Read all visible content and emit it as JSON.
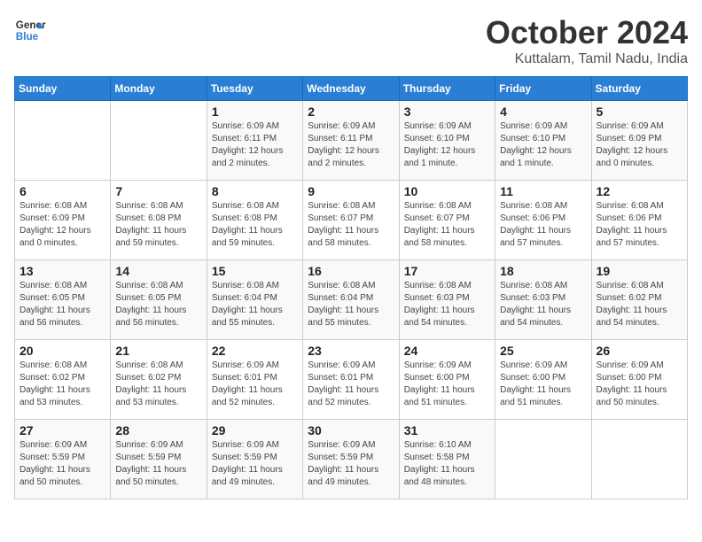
{
  "header": {
    "logo_line1": "General",
    "logo_line2": "Blue",
    "month": "October 2024",
    "location": "Kuttalam, Tamil Nadu, India"
  },
  "weekdays": [
    "Sunday",
    "Monday",
    "Tuesday",
    "Wednesday",
    "Thursday",
    "Friday",
    "Saturday"
  ],
  "weeks": [
    [
      {
        "day": "",
        "info": ""
      },
      {
        "day": "",
        "info": ""
      },
      {
        "day": "1",
        "info": "Sunrise: 6:09 AM\nSunset: 6:11 PM\nDaylight: 12 hours and 2 minutes."
      },
      {
        "day": "2",
        "info": "Sunrise: 6:09 AM\nSunset: 6:11 PM\nDaylight: 12 hours and 2 minutes."
      },
      {
        "day": "3",
        "info": "Sunrise: 6:09 AM\nSunset: 6:10 PM\nDaylight: 12 hours and 1 minute."
      },
      {
        "day": "4",
        "info": "Sunrise: 6:09 AM\nSunset: 6:10 PM\nDaylight: 12 hours and 1 minute."
      },
      {
        "day": "5",
        "info": "Sunrise: 6:09 AM\nSunset: 6:09 PM\nDaylight: 12 hours and 0 minutes."
      }
    ],
    [
      {
        "day": "6",
        "info": "Sunrise: 6:08 AM\nSunset: 6:09 PM\nDaylight: 12 hours and 0 minutes."
      },
      {
        "day": "7",
        "info": "Sunrise: 6:08 AM\nSunset: 6:08 PM\nDaylight: 11 hours and 59 minutes."
      },
      {
        "day": "8",
        "info": "Sunrise: 6:08 AM\nSunset: 6:08 PM\nDaylight: 11 hours and 59 minutes."
      },
      {
        "day": "9",
        "info": "Sunrise: 6:08 AM\nSunset: 6:07 PM\nDaylight: 11 hours and 58 minutes."
      },
      {
        "day": "10",
        "info": "Sunrise: 6:08 AM\nSunset: 6:07 PM\nDaylight: 11 hours and 58 minutes."
      },
      {
        "day": "11",
        "info": "Sunrise: 6:08 AM\nSunset: 6:06 PM\nDaylight: 11 hours and 57 minutes."
      },
      {
        "day": "12",
        "info": "Sunrise: 6:08 AM\nSunset: 6:06 PM\nDaylight: 11 hours and 57 minutes."
      }
    ],
    [
      {
        "day": "13",
        "info": "Sunrise: 6:08 AM\nSunset: 6:05 PM\nDaylight: 11 hours and 56 minutes."
      },
      {
        "day": "14",
        "info": "Sunrise: 6:08 AM\nSunset: 6:05 PM\nDaylight: 11 hours and 56 minutes."
      },
      {
        "day": "15",
        "info": "Sunrise: 6:08 AM\nSunset: 6:04 PM\nDaylight: 11 hours and 55 minutes."
      },
      {
        "day": "16",
        "info": "Sunrise: 6:08 AM\nSunset: 6:04 PM\nDaylight: 11 hours and 55 minutes."
      },
      {
        "day": "17",
        "info": "Sunrise: 6:08 AM\nSunset: 6:03 PM\nDaylight: 11 hours and 54 minutes."
      },
      {
        "day": "18",
        "info": "Sunrise: 6:08 AM\nSunset: 6:03 PM\nDaylight: 11 hours and 54 minutes."
      },
      {
        "day": "19",
        "info": "Sunrise: 6:08 AM\nSunset: 6:02 PM\nDaylight: 11 hours and 54 minutes."
      }
    ],
    [
      {
        "day": "20",
        "info": "Sunrise: 6:08 AM\nSunset: 6:02 PM\nDaylight: 11 hours and 53 minutes."
      },
      {
        "day": "21",
        "info": "Sunrise: 6:08 AM\nSunset: 6:02 PM\nDaylight: 11 hours and 53 minutes."
      },
      {
        "day": "22",
        "info": "Sunrise: 6:09 AM\nSunset: 6:01 PM\nDaylight: 11 hours and 52 minutes."
      },
      {
        "day": "23",
        "info": "Sunrise: 6:09 AM\nSunset: 6:01 PM\nDaylight: 11 hours and 52 minutes."
      },
      {
        "day": "24",
        "info": "Sunrise: 6:09 AM\nSunset: 6:00 PM\nDaylight: 11 hours and 51 minutes."
      },
      {
        "day": "25",
        "info": "Sunrise: 6:09 AM\nSunset: 6:00 PM\nDaylight: 11 hours and 51 minutes."
      },
      {
        "day": "26",
        "info": "Sunrise: 6:09 AM\nSunset: 6:00 PM\nDaylight: 11 hours and 50 minutes."
      }
    ],
    [
      {
        "day": "27",
        "info": "Sunrise: 6:09 AM\nSunset: 5:59 PM\nDaylight: 11 hours and 50 minutes."
      },
      {
        "day": "28",
        "info": "Sunrise: 6:09 AM\nSunset: 5:59 PM\nDaylight: 11 hours and 50 minutes."
      },
      {
        "day": "29",
        "info": "Sunrise: 6:09 AM\nSunset: 5:59 PM\nDaylight: 11 hours and 49 minutes."
      },
      {
        "day": "30",
        "info": "Sunrise: 6:09 AM\nSunset: 5:59 PM\nDaylight: 11 hours and 49 minutes."
      },
      {
        "day": "31",
        "info": "Sunrise: 6:10 AM\nSunset: 5:58 PM\nDaylight: 11 hours and 48 minutes."
      },
      {
        "day": "",
        "info": ""
      },
      {
        "day": "",
        "info": ""
      }
    ]
  ]
}
